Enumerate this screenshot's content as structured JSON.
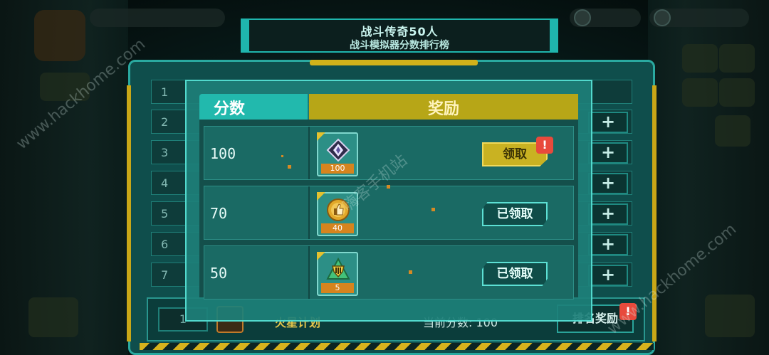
{
  "banner": {
    "title": "战斗传奇50人",
    "subtitle": "战斗模拟器分数排行榜"
  },
  "popup": {
    "header_score": "分数",
    "header_reward": "奖励",
    "rows": [
      {
        "score": "100",
        "item_icon": "diamond-emblem-icon",
        "item_qty": "100",
        "button": "领取",
        "button_state": "claimable",
        "alert": "!"
      },
      {
        "score": "70",
        "item_icon": "thumbs-up-coin-icon",
        "item_qty": "40",
        "button": "已领取",
        "button_state": "claimed"
      },
      {
        "score": "50",
        "item_icon": "shield-badge-icon",
        "item_qty": "5",
        "button": "已领取",
        "button_state": "claimed"
      }
    ]
  },
  "leaderboard": {
    "row_numbers": [
      "1",
      "2",
      "3",
      "4",
      "5",
      "6",
      "7"
    ],
    "plus_label": "+"
  },
  "self_row": {
    "rank": "1",
    "name": "火星计划",
    "score": "当前分数: 100",
    "rank_reward_button": "排名奖励",
    "alert": "!"
  },
  "watermarks": {
    "left": "www.hackhome.com",
    "center": "嗨客手机站",
    "right": "www.hackhome.com"
  },
  "colors": {
    "accent_teal": "#22b9ad",
    "reward_gold": "#b7a617",
    "claim_yellow": "#c9b222",
    "alert_red": "#e84a3c"
  }
}
